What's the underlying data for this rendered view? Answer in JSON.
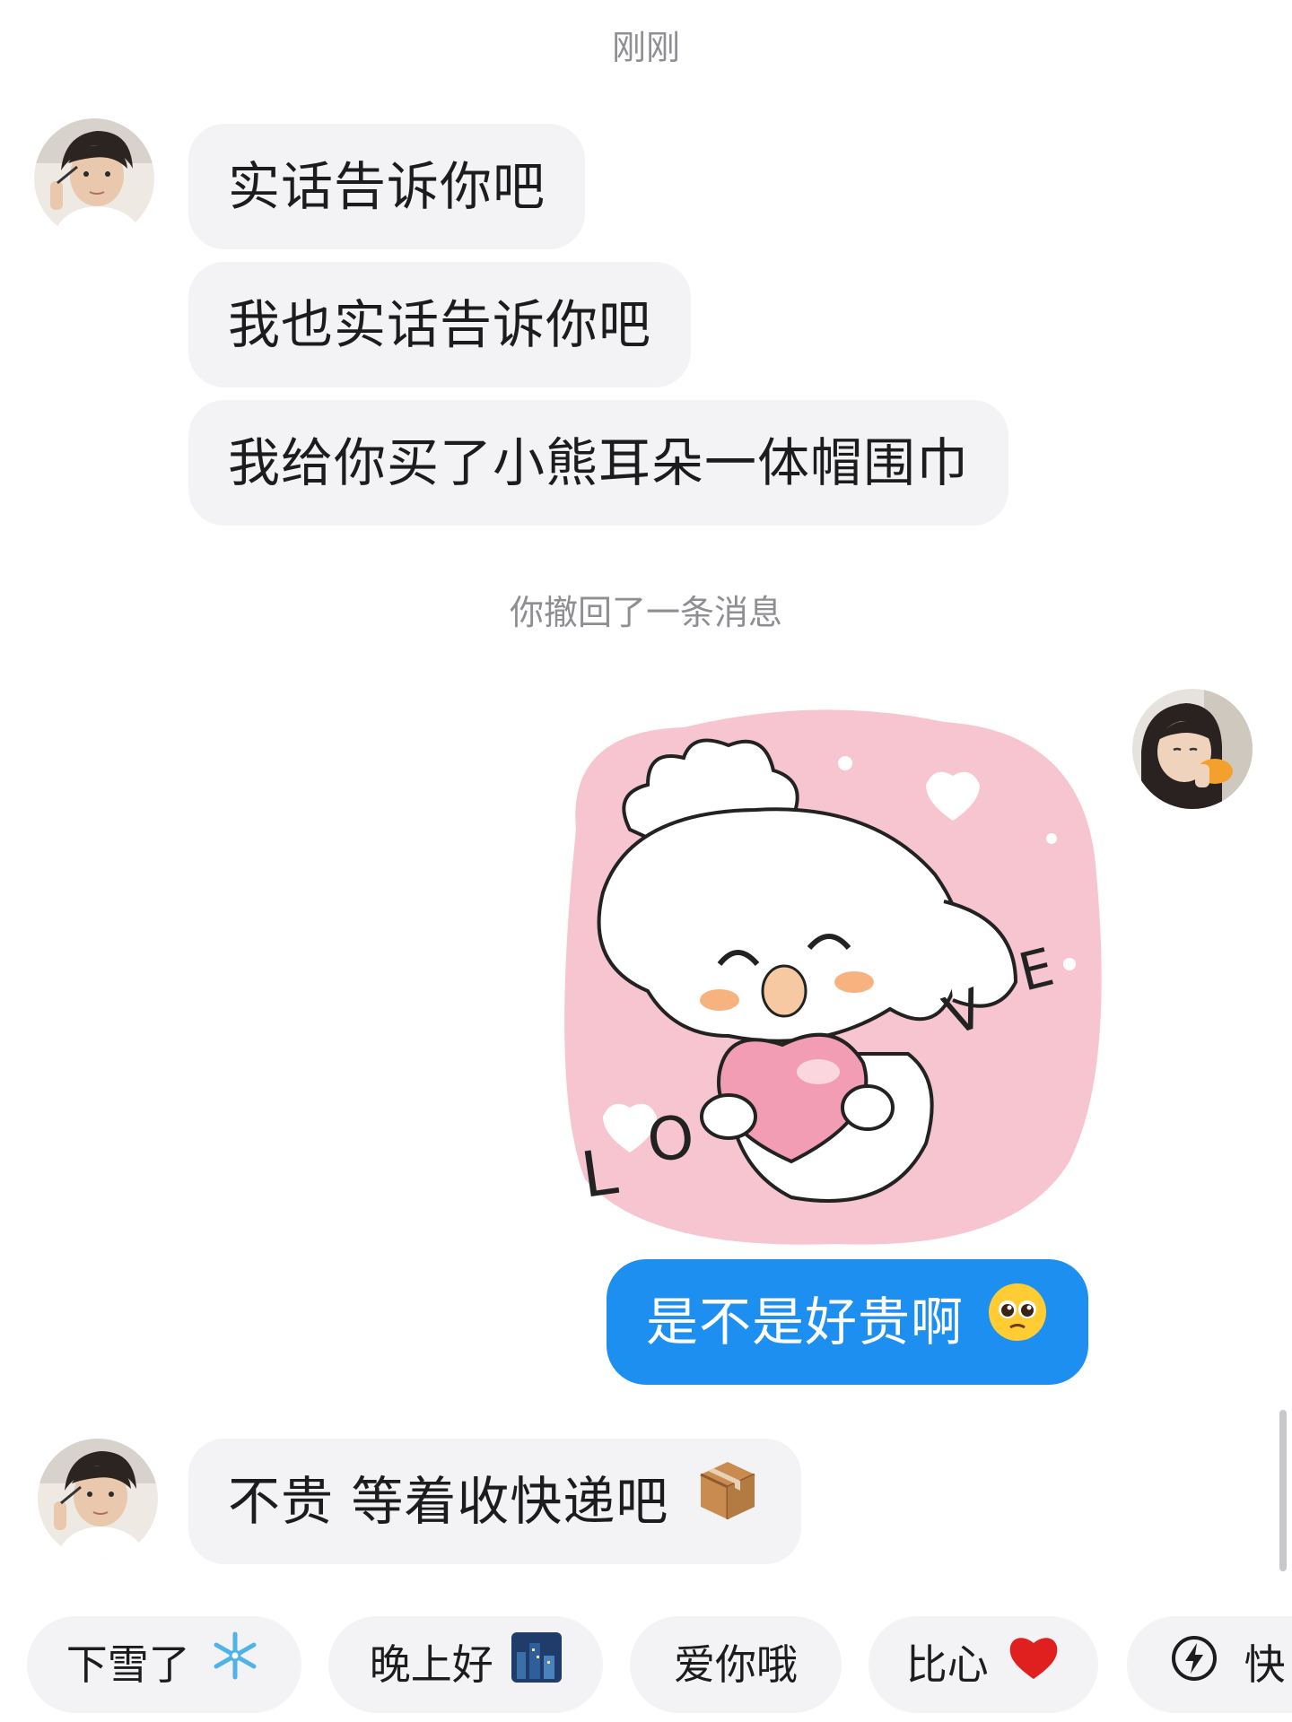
{
  "timestamp": "刚刚",
  "recall_notice": "你撤回了一条消息",
  "messages": [
    {
      "text": "实话告诉你吧"
    },
    {
      "text": "我也实话告诉你吧"
    },
    {
      "text": "我给你买了小熊耳朵一体帽围巾"
    },
    {
      "text": "是不是好贵啊"
    },
    {
      "text": "不贵 等着收快递吧"
    }
  ],
  "sticker": {
    "letters": [
      "L",
      "O",
      "V",
      "E"
    ]
  },
  "quick_replies": [
    {
      "label": "下雪了",
      "icon": "snowflake-icon"
    },
    {
      "label": "晚上好",
      "icon": "night-city-icon"
    },
    {
      "label": "爱你哦",
      "icon": ""
    },
    {
      "label": "比心",
      "icon": "red-heart-icon"
    },
    {
      "label": "快",
      "icon": "lightning-icon"
    }
  ],
  "colors": {
    "outgoing_bubble": "#1d8ff0",
    "incoming_bubble": "#f3f3f5",
    "system_text": "#8e8e93"
  }
}
